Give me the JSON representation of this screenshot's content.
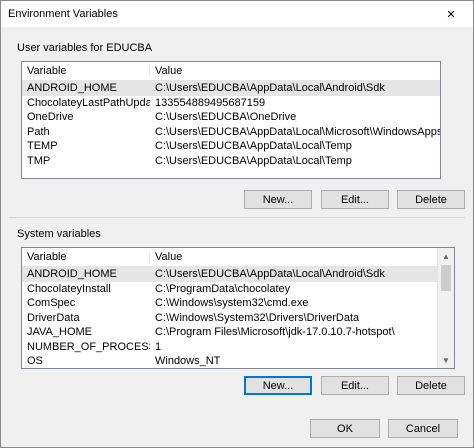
{
  "window": {
    "title": "Environment Variables",
    "close_glyph": "✕"
  },
  "user_vars": {
    "group_label": "User variables for EDUCBA",
    "columns": {
      "variable": "Variable",
      "value": "Value"
    },
    "rows": [
      {
        "variable": "ANDROID_HOME",
        "value": "C:\\Users\\EDUCBA\\AppData\\Local\\Android\\Sdk"
      },
      {
        "variable": "ChocolateyLastPathUpdate",
        "value": "133554889495687159"
      },
      {
        "variable": "OneDrive",
        "value": "C:\\Users\\EDUCBA\\OneDrive"
      },
      {
        "variable": "Path",
        "value": "C:\\Users\\EDUCBA\\AppData\\Local\\Microsoft\\WindowsApps;C:\\User..."
      },
      {
        "variable": "TEMP",
        "value": "C:\\Users\\EDUCBA\\AppData\\Local\\Temp"
      },
      {
        "variable": "TMP",
        "value": "C:\\Users\\EDUCBA\\AppData\\Local\\Temp"
      }
    ],
    "buttons": {
      "new": "New...",
      "edit": "Edit...",
      "delete": "Delete"
    }
  },
  "system_vars": {
    "group_label": "System variables",
    "columns": {
      "variable": "Variable",
      "value": "Value"
    },
    "rows": [
      {
        "variable": "ANDROID_HOME",
        "value": "C:\\Users\\EDUCBA\\AppData\\Local\\Android\\Sdk"
      },
      {
        "variable": "ChocolateyInstall",
        "value": "C:\\ProgramData\\chocolatey"
      },
      {
        "variable": "ComSpec",
        "value": "C:\\Windows\\system32\\cmd.exe"
      },
      {
        "variable": "DriverData",
        "value": "C:\\Windows\\System32\\Drivers\\DriverData"
      },
      {
        "variable": "JAVA_HOME",
        "value": "C:\\Program Files\\Microsoft\\jdk-17.0.10.7-hotspot\\"
      },
      {
        "variable": "NUMBER_OF_PROCESSORS",
        "value": "1"
      },
      {
        "variable": "OS",
        "value": "Windows_NT"
      }
    ],
    "buttons": {
      "new": "New...",
      "edit": "Edit...",
      "delete": "Delete"
    }
  },
  "footer": {
    "ok": "OK",
    "cancel": "Cancel"
  },
  "icons": {
    "close": "close-icon",
    "scroll_up": "chevron-up-icon",
    "scroll_down": "chevron-down-icon"
  }
}
